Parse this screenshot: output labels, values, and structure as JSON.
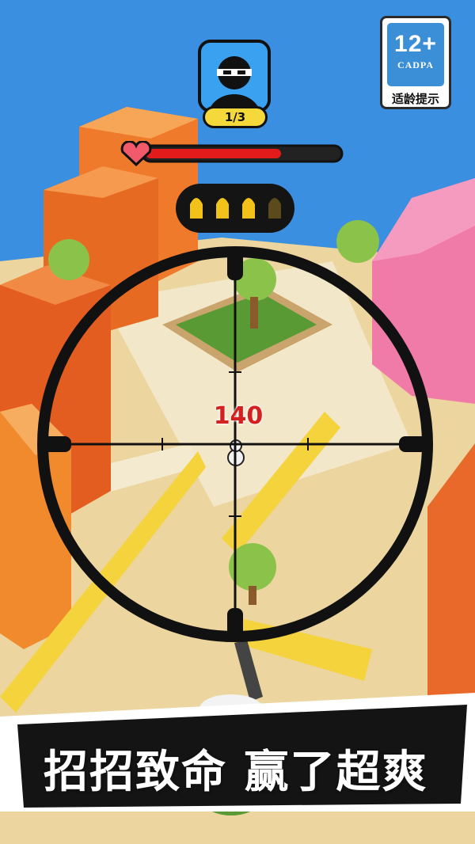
{
  "hud": {
    "target_counter": "1/3",
    "health_fraction": 0.7,
    "ammo": {
      "total": 4,
      "remaining": 3
    },
    "score_popup": "140",
    "colors": {
      "health_fill": "#e31b1b",
      "ammo_full": "#f2c21a",
      "ammo_empty": "#5b4a1c",
      "accent_yellow": "#f5d93a"
    }
  },
  "age_badge": {
    "rating": "12+",
    "org": "CADPA",
    "caption": "适龄提示"
  },
  "slogan": {
    "text": "招招致命 赢了超爽"
  },
  "icons": {
    "target": "masked-thief-icon",
    "health": "heart-icon",
    "ammo": "bullet-icon",
    "crosshair": "sniper-scope-icon"
  }
}
